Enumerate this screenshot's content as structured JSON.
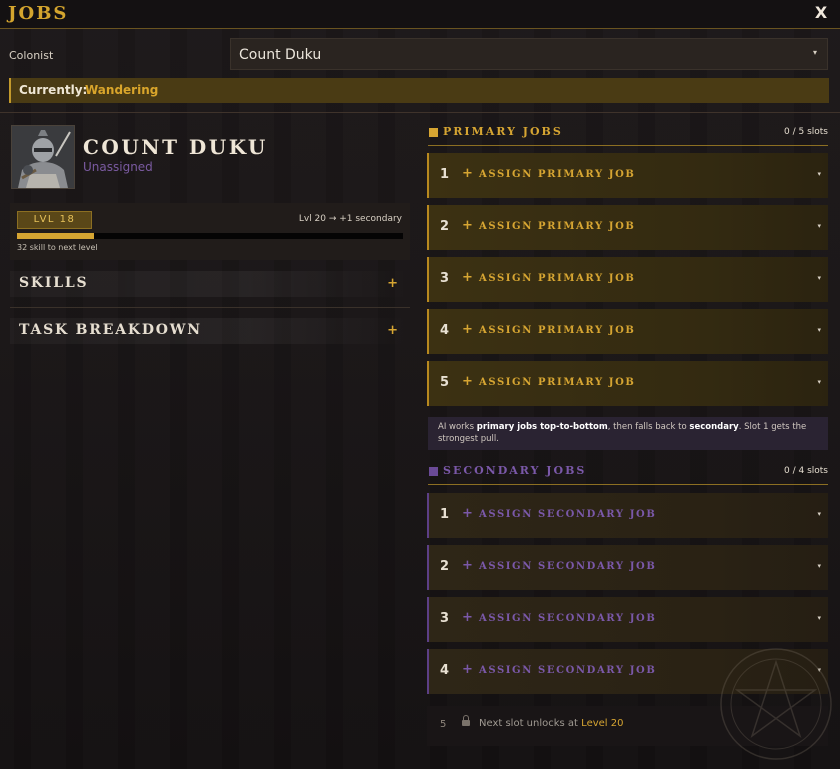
{
  "window": {
    "title": "JOBS",
    "close_label": "X"
  },
  "colonist": {
    "label": "Colonist",
    "selected": "Count Duku"
  },
  "status": {
    "label": "Currently:",
    "value": "Wandering"
  },
  "profile": {
    "name": "COUNT DUKU",
    "role": "Unassigned",
    "level_label": "LVL 18",
    "next_level_text": "Lvl 20 → +1 secondary",
    "xp_progress_fraction": 0.2,
    "xp_note": "32 skill to next level"
  },
  "sections": {
    "skills": {
      "label": "SKILLS",
      "toggle": "+"
    },
    "task_breakdown": {
      "label": "TASK BREAKDOWN",
      "toggle": "+"
    }
  },
  "primary": {
    "title": "PRIMARY JOBS",
    "count": "0 / 5 slots",
    "slots": [
      {
        "num": "1",
        "label": "ASSIGN PRIMARY JOB"
      },
      {
        "num": "2",
        "label": "ASSIGN PRIMARY JOB"
      },
      {
        "num": "3",
        "label": "ASSIGN PRIMARY JOB"
      },
      {
        "num": "4",
        "label": "ASSIGN PRIMARY JOB"
      },
      {
        "num": "5",
        "label": "ASSIGN PRIMARY JOB"
      }
    ]
  },
  "note": {
    "t1": "AI works ",
    "b1": "primary jobs top-to-bottom",
    "t2": ", then falls back to ",
    "b2": "secondary",
    "t3": ". Slot 1 gets the strongest pull."
  },
  "secondary": {
    "title": "SECONDARY JOBS",
    "count": "0 / 4 slots",
    "slots": [
      {
        "num": "1",
        "label": "ASSIGN SECONDARY JOB"
      },
      {
        "num": "2",
        "label": "ASSIGN SECONDARY JOB"
      },
      {
        "num": "3",
        "label": "ASSIGN SECONDARY JOB"
      },
      {
        "num": "4",
        "label": "ASSIGN SECONDARY JOB"
      }
    ],
    "locked": {
      "num": "5",
      "text": "Next slot unlocks at ",
      "level": "Level 20"
    }
  },
  "icons": {
    "plus": "+",
    "caret": "▾",
    "close": "close-icon",
    "lock": "lock-icon",
    "emblem": "pentagram-emblem"
  },
  "colors": {
    "gold": "#d6a532",
    "purple": "#7a58a8",
    "status_bar": "#4a3b14"
  }
}
